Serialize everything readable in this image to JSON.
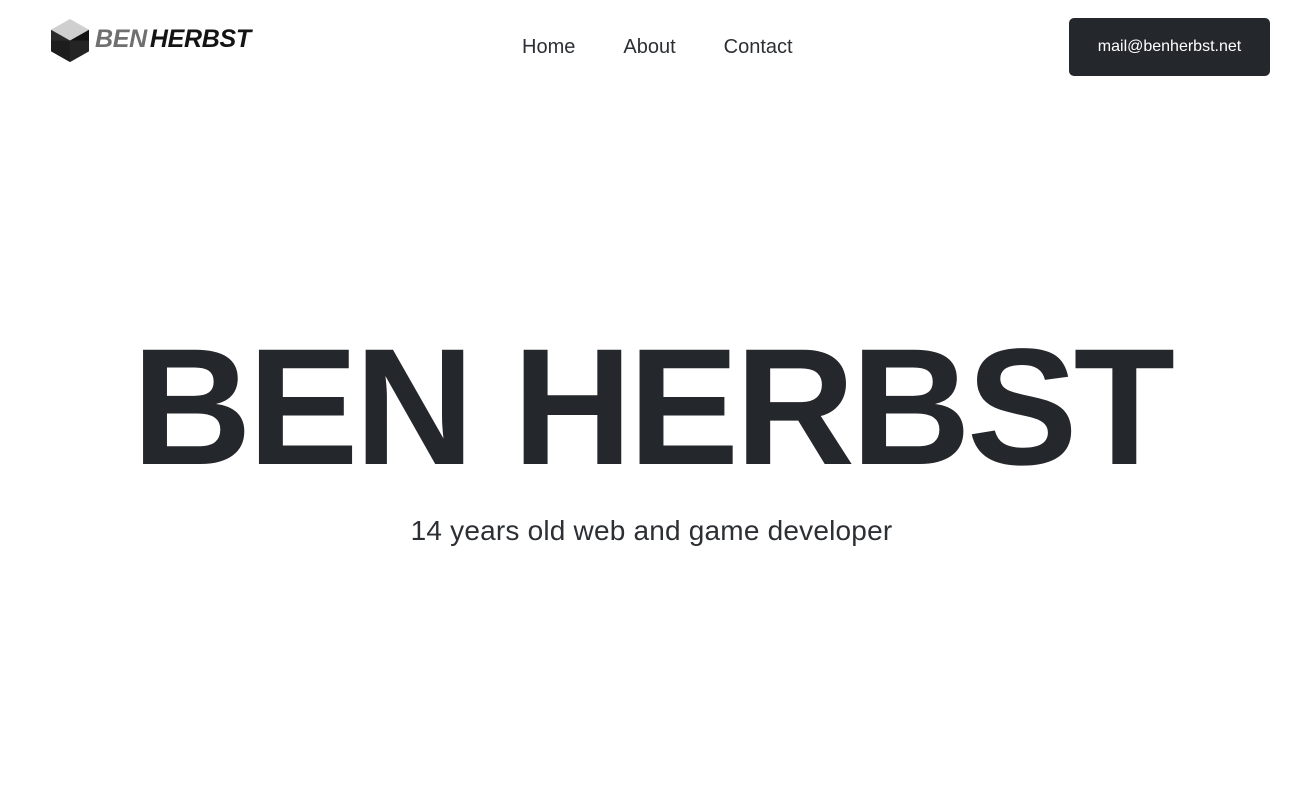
{
  "header": {
    "logo": {
      "first": "BEN",
      "last": "HERBST",
      "icon": "hexagon-cube-logo-icon"
    },
    "nav": [
      {
        "label": "Home"
      },
      {
        "label": "About"
      },
      {
        "label": "Contact"
      }
    ],
    "contact_button": "mail@benherbst.net"
  },
  "hero": {
    "title": "BEN HERBST",
    "subtitle": "14 years old web and game developer"
  },
  "colors": {
    "primary_dark": "#24272b",
    "logo_first_gray": "#6f6f6f",
    "background": "#ffffff"
  }
}
